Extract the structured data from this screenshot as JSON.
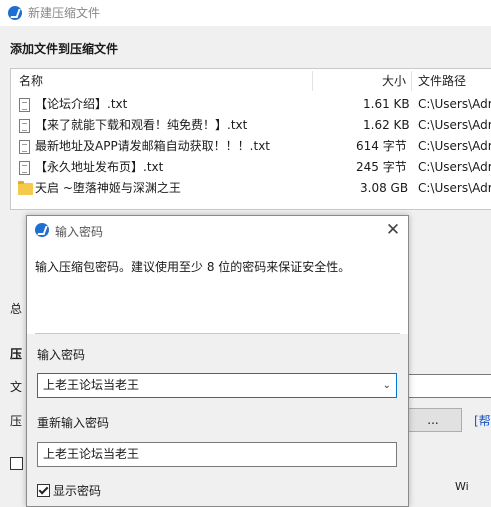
{
  "main_window": {
    "title": "新建压缩文件",
    "section_heading": "添加文件到压缩文件",
    "columns": {
      "name": "名称",
      "size": "大小",
      "path": "文件路径"
    },
    "files": [
      {
        "icon": "document-icon",
        "name": "【论坛介绍】.txt",
        "size": "1.61 KB",
        "path": "C:\\Users\\Adr"
      },
      {
        "icon": "document-icon",
        "name": "【来了就能下载和观看！纯免费！】.txt",
        "size": "1.62 KB",
        "path": "C:\\Users\\Adr"
      },
      {
        "icon": "document-icon",
        "name": "最新地址及APP请发邮箱自动获取！！！.txt",
        "size": "614 字节",
        "path": "C:\\Users\\Adr"
      },
      {
        "icon": "document-icon",
        "name": "【永久地址发布页】.txt",
        "size": "245 字节",
        "path": "C:\\Users\\Adr"
      },
      {
        "icon": "folder-icon",
        "name": "天启 ~堕落神姬与深渊之王",
        "size": "3.08 GB",
        "path": "C:\\Users\\Adr"
      }
    ],
    "partial_labels": {
      "total": "总",
      "compress_heading": "压",
      "file": "文",
      "compress": "压"
    },
    "browse_button": "...",
    "help_link": "[帮",
    "footer_fragment": "Wi"
  },
  "dialog": {
    "title": "输入密码",
    "description": "输入压缩包密码。建议使用至少 8 位的密码来保证安全性。",
    "password_label": "输入密码",
    "password_value": "上老王论坛当老王",
    "confirm_label": "重新输入密码",
    "confirm_value": "上老王论坛当老王",
    "show_password_label": "显示密码",
    "show_password_checked": true
  },
  "colors": {
    "accent": "#1f6fd0",
    "focus_border": "#0078d7",
    "folder": "#f6c94a",
    "link": "#1a55c4"
  }
}
